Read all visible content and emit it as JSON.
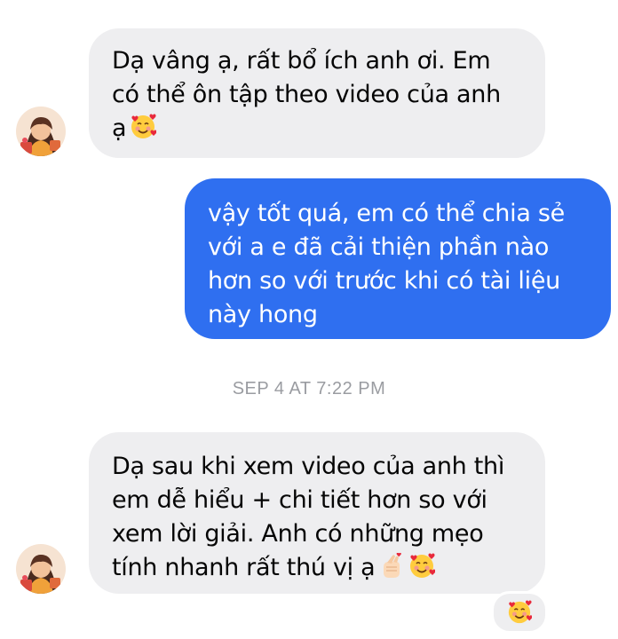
{
  "conversation": {
    "messages": [
      {
        "sender": "contact",
        "lines": [
          "Dạ vâng ạ, rất bổ ích anh ơi. Em",
          "có thể ôn tập theo video của anh",
          "ạ"
        ],
        "trailing_emoji": [
          "smiling-face-with-hearts-icon"
        ]
      },
      {
        "sender": "self",
        "lines": [
          "vậy tốt quá, em có thể chia sẻ",
          "với a e đã cải thiện phần nào",
          "hơn so với trước khi có tài liệu",
          "này hong"
        ]
      },
      {
        "sender": "contact",
        "lines": [
          "Dạ sau khi xem video của anh thì",
          "em dễ hiểu + chi tiết hơn so với",
          "xem lời giải. Anh có những mẹo",
          "tính nhanh rất thú vị ạ"
        ],
        "trailing_emoji": [
          "hand-with-index-finger-and-thumb-crossed-icon",
          "smiling-face-with-hearts-icon"
        ],
        "reaction": "smiling-face-with-hearts-icon"
      }
    ],
    "timestamp": "SEP 4 AT 7:22 PM"
  },
  "colors": {
    "sent_bubble": "#2f6ff0",
    "received_bubble": "#eeeef0",
    "timestamp_text": "#9a9ca1"
  }
}
